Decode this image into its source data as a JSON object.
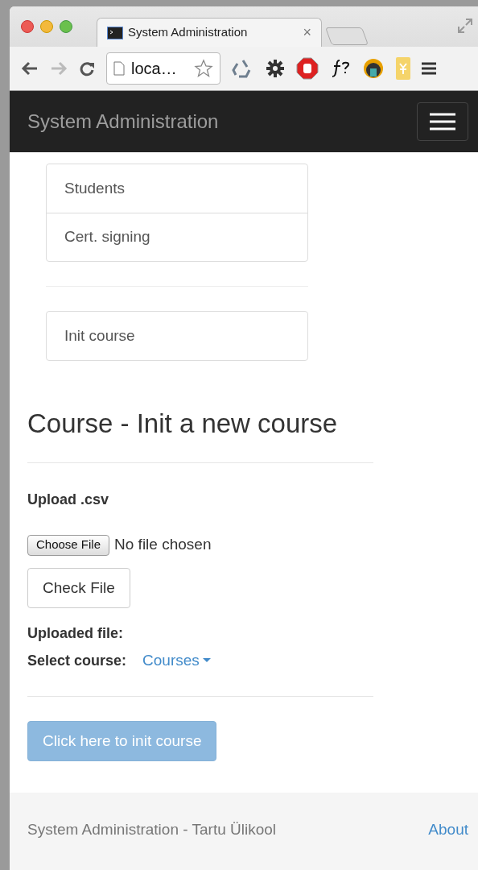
{
  "browser": {
    "tab_title": "System Administration",
    "tab_close": "×",
    "address": "loca…"
  },
  "navbar": {
    "brand": "System Administration"
  },
  "menu_groups": [
    [
      {
        "label": "Students"
      },
      {
        "label": "Cert. signing"
      }
    ],
    [
      {
        "label": "Init course"
      }
    ]
  ],
  "heading": "Course - Init a new course",
  "upload_label": "Upload .csv",
  "file_input": {
    "button": "Choose File",
    "status": "No file chosen"
  },
  "check_button": "Check File",
  "uploaded_label": "Uploaded file:",
  "select_label": "Select course:",
  "courses_dropdown": "Courses",
  "init_button": {
    "label": "Click here to init course",
    "disabled": true
  },
  "footer": {
    "text": "System Administration - Tartu Ülikool",
    "link": "About"
  }
}
